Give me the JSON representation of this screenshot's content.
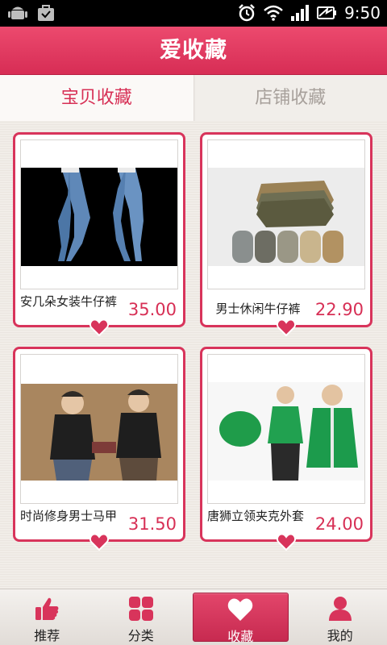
{
  "status_bar": {
    "time": "9:50",
    "icons": [
      "android-debug-icon",
      "download-bag-icon",
      "alarm-icon",
      "wifi-icon",
      "signal-icon",
      "battery-icon"
    ]
  },
  "header": {
    "title": "爱收藏"
  },
  "tabs": [
    {
      "label": "宝贝收藏",
      "active": true
    },
    {
      "label": "店铺收藏",
      "active": false
    }
  ],
  "products": [
    {
      "name": "安几朵女装牛仔裤",
      "price": "35.00",
      "image": "jeans-photo"
    },
    {
      "name": "男士休闲牛仔裤",
      "price": "22.90",
      "image": "folded-pants-photo"
    },
    {
      "name": "时尚修身男士马甲",
      "price": "31.50",
      "image": "vest-models-photo"
    },
    {
      "name": "唐狮立领夹克外套",
      "price": "24.00",
      "image": "green-jacket-photo"
    }
  ],
  "bottom_nav": [
    {
      "label": "推荐",
      "icon": "thumbs-up-icon",
      "active": false
    },
    {
      "label": "分类",
      "icon": "grid-icon",
      "active": false
    },
    {
      "label": "收藏",
      "icon": "heart-icon",
      "active": true
    },
    {
      "label": "我的",
      "icon": "user-icon",
      "active": false
    }
  ],
  "colors": {
    "accent": "#d72f55",
    "header_top": "#ec4a6e",
    "background": "#ede8e2"
  }
}
